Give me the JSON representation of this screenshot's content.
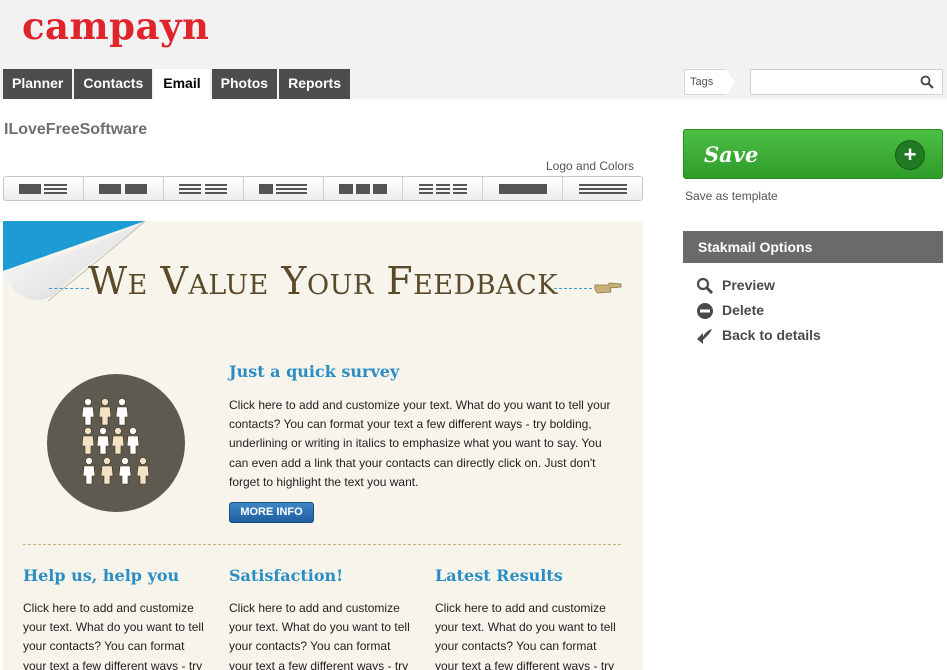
{
  "brand": {
    "logo_text": "campayn",
    "logo_color": "#e0242c"
  },
  "tabs": [
    {
      "label": "Planner",
      "active": false
    },
    {
      "label": "Contacts",
      "active": false
    },
    {
      "label": "Email",
      "active": true
    },
    {
      "label": "Photos",
      "active": false
    },
    {
      "label": "Reports",
      "active": false
    }
  ],
  "tags": {
    "label": "Tags",
    "input_value": "",
    "search_icon": "search-icon"
  },
  "campaign": {
    "title": "ILoveFreeSoftware",
    "logo_and_colors_link": "Logo and Colors"
  },
  "layout_options": [
    "layout-1",
    "layout-2",
    "layout-3",
    "layout-4",
    "layout-5",
    "layout-6",
    "layout-7",
    "layout-8"
  ],
  "email": {
    "headline": "We Value Your Feedback",
    "survey": {
      "title": "Just a quick survey",
      "text": "Click here to add and customize your text. What do you want to tell your contacts? You can format your text a few different ways - try bolding, underlining or writing in italics to emphasize what you want to say. You can even add a link that your contacts can directly click on. Just don't forget to highlight the text you want.",
      "button": "MORE INFO"
    },
    "columns": [
      {
        "title": "Help us, help you",
        "text": "Click here to add and customize your text. What do you want to tell your contacts? You can format your text a few different ways - try"
      },
      {
        "title": "Satisfaction!",
        "text": "Click here to add and customize your text. What do you want to tell your contacts? You can format your text a few different ways - try"
      },
      {
        "title": "Latest Results",
        "text": "Click here to add and customize your text. What do you want to tell your contacts? You can format your text a few different ways - try"
      }
    ]
  },
  "sidebar": {
    "save_label": "Save",
    "save_template": "Save as template",
    "options_header": "Stakmail Options",
    "actions": [
      {
        "label": "Preview",
        "icon": "magnifier-icon"
      },
      {
        "label": "Delete",
        "icon": "minus-circle-icon"
      },
      {
        "label": "Back to details",
        "icon": "back-arrow-icon"
      }
    ]
  },
  "colors": {
    "accent_green": "#3fae38",
    "link_blue": "#2a8dc4",
    "tab_dark": "#4d4d4d"
  }
}
